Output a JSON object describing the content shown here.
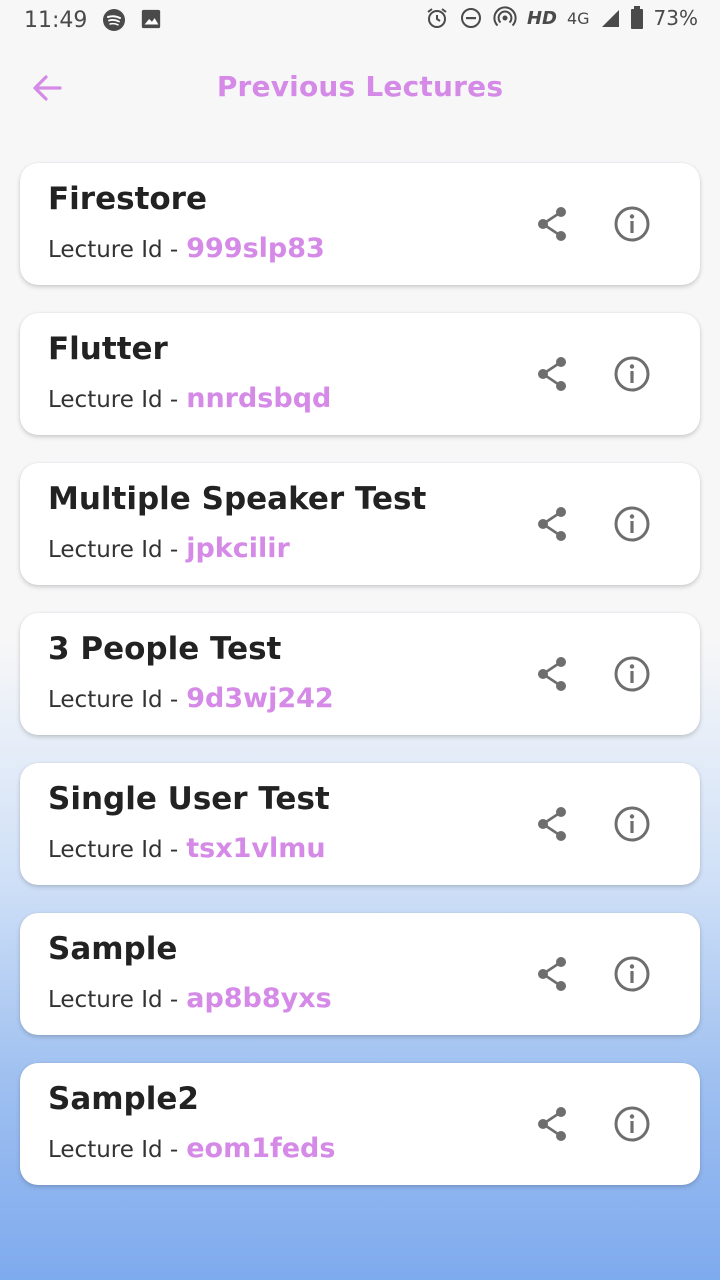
{
  "status_bar": {
    "time": "11:49",
    "network_hd": "HD",
    "network_type": "4G",
    "battery": "73%"
  },
  "app_bar": {
    "title": "Previous Lectures"
  },
  "lectures": [
    {
      "title": "Firestore",
      "id_label": "Lecture Id -",
      "id": "999slp83"
    },
    {
      "title": "Flutter",
      "id_label": "Lecture Id -",
      "id": "nnrdsbqd"
    },
    {
      "title": "Multiple Speaker Test",
      "id_label": "Lecture Id -",
      "id": "jpkcilir"
    },
    {
      "title": "3 People Test",
      "id_label": "Lecture Id -",
      "id": "9d3wj242"
    },
    {
      "title": "Single User Test",
      "id_label": "Lecture Id -",
      "id": "tsx1vlmu"
    },
    {
      "title": "Sample",
      "id_label": "Lecture Id -",
      "id": "ap8b8yxs"
    },
    {
      "title": "Sample2",
      "id_label": "Lecture Id -",
      "id": "eom1feds"
    }
  ],
  "icons": {
    "back": "arrow-left-icon",
    "share": "share-icon",
    "info": "info-icon"
  },
  "colors": {
    "accent": "#d48ae6",
    "icon_gray": "#6e6e6e",
    "gradient_bottom": "#7eaaee"
  }
}
